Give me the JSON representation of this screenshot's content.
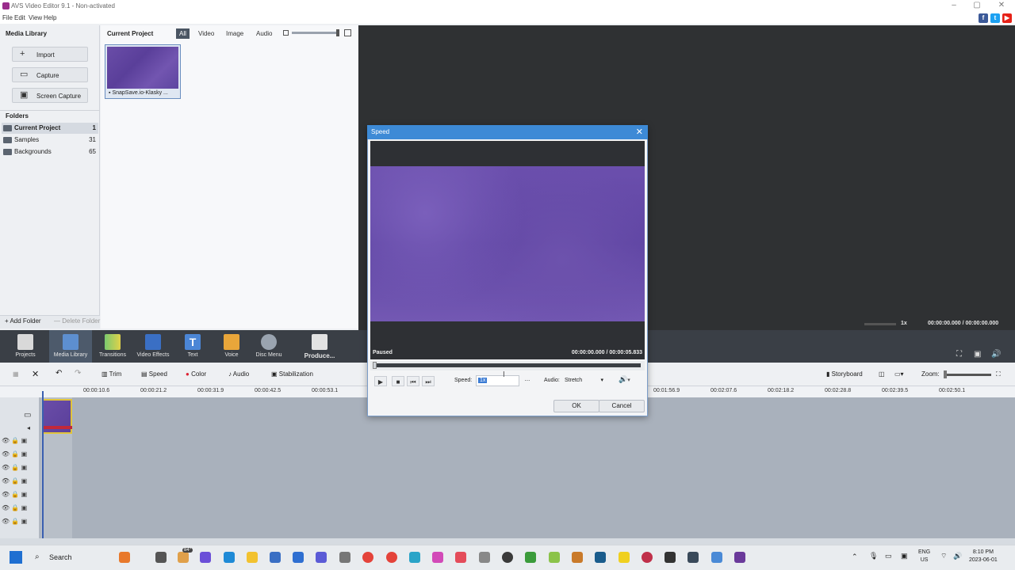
{
  "app": {
    "title": "AVS Video Editor 9.1 - Non-activated",
    "menu": [
      "File",
      "Edit",
      "View",
      "Help"
    ],
    "social": [
      "f",
      "t",
      "▶"
    ]
  },
  "media_library": {
    "header": "Media Library",
    "buttons": [
      "Import",
      "Capture",
      "Screen Capture"
    ],
    "folders_header": "Folders",
    "folders": [
      {
        "name": "Current Project",
        "count": "1"
      },
      {
        "name": "Samples",
        "count": "31"
      },
      {
        "name": "Backgrounds",
        "count": "65"
      }
    ],
    "add_folder": "Add Folder",
    "delete_folder": "Delete Folder"
  },
  "project": {
    "header": "Current Project",
    "filters": [
      "All",
      "Video",
      "Image",
      "Audio"
    ],
    "clip_name": "SnapSave.io-Klasky ..."
  },
  "preview": {
    "speed": "1x",
    "time": "00:00:00.000 / 00:00:00.000"
  },
  "toolbar": {
    "items": [
      "Projects",
      "Media Library",
      "Transitions",
      "Video Effects",
      "Text",
      "Voice",
      "Disc Menu",
      "Produce..."
    ]
  },
  "timeline_tools": {
    "items": [
      "Trim",
      "Speed",
      "Color",
      "Audio",
      "Stabilization"
    ],
    "storyboard": "Storyboard",
    "zoom": "Zoom:"
  },
  "ruler": [
    "00:00:10.6",
    "00:00:21.2",
    "00:00:31.9",
    "00:00:42.5",
    "00:00:53.1",
    "00:01:56.9",
    "00:02:07.6",
    "00:02:18.2",
    "00:02:28.8",
    "00:02:39.5",
    "00:02:50.1"
  ],
  "dialog": {
    "title": "Speed",
    "status": "Paused",
    "time": "00:00:00.000 / 00:00:05.833",
    "speed_label": "Speed:",
    "speed_value": "1x",
    "more": "...",
    "audio_label": "Audio:",
    "audio_value": "Stretch",
    "ok": "OK",
    "cancel": "Cancel"
  },
  "taskbar": {
    "search": "Search",
    "weather": "84°",
    "lang": "ENG",
    "region": "US",
    "time": "8:10 PM",
    "date": "2023-06-01"
  }
}
